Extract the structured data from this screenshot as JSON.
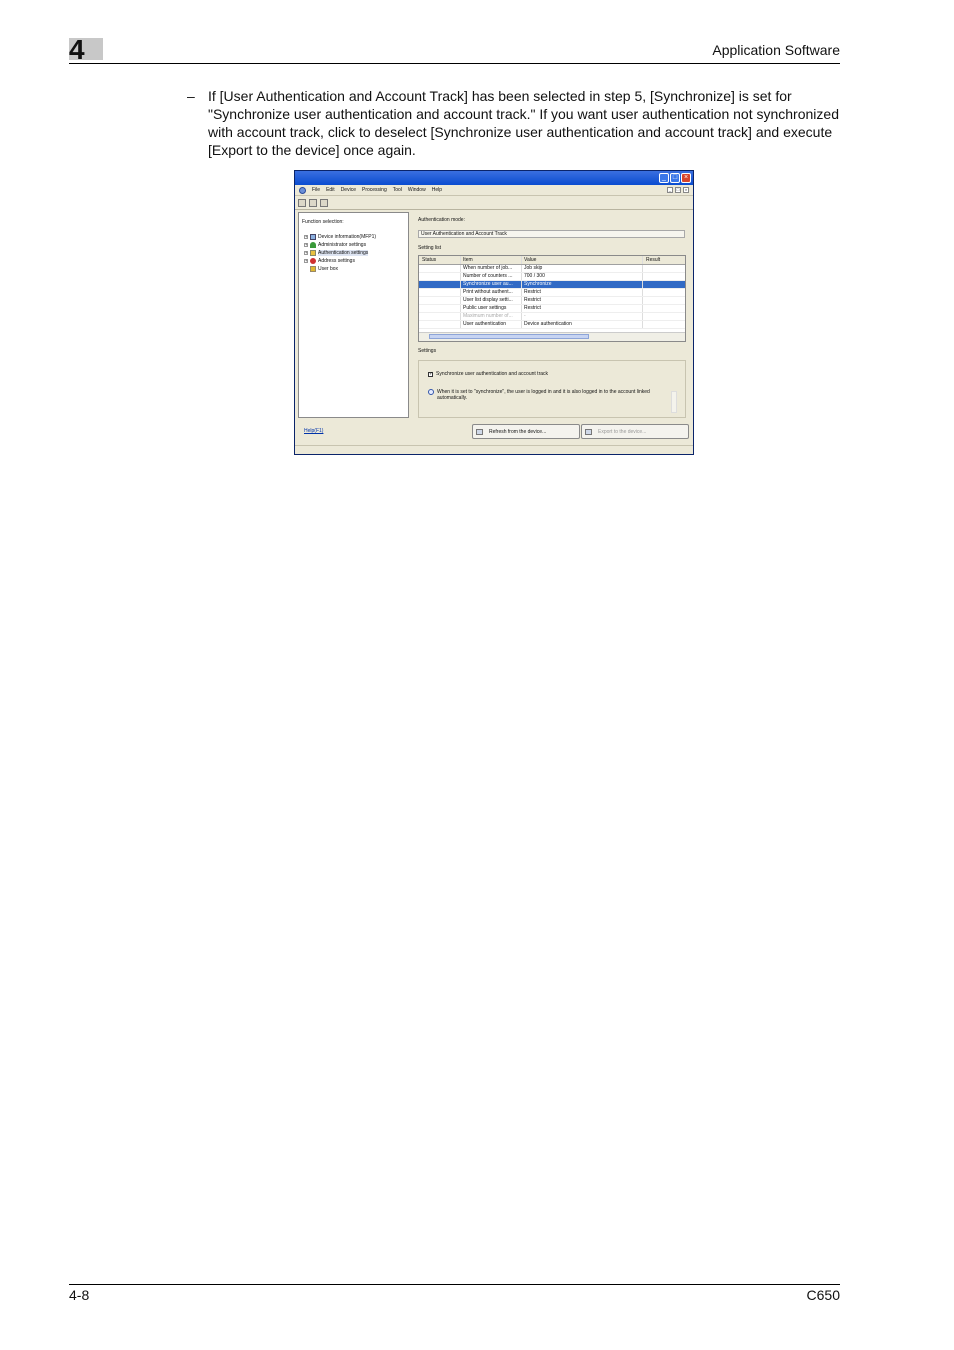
{
  "header": {
    "chapter": "4",
    "title": "Application Software"
  },
  "body": {
    "bullet": "–",
    "paragraph": "If [User Authentication and Account Track] has been selected in step 5, [Synchronize] is set for \"Synchronize user authentication and account track.\" If you want user authentication not synchronized with account track, click to deselect [Synchronize user authentication and account track] and execute [Export to the device] once again."
  },
  "screenshot": {
    "menu": [
      "File",
      "Edit",
      "Device",
      "Processing",
      "Tool",
      "Window",
      "Help"
    ],
    "function_selection_label": "Function selection:",
    "tree": [
      {
        "label": "Device information(MFP1)"
      },
      {
        "label": "Administrator settings"
      },
      {
        "label": "Authentication settings"
      },
      {
        "label": "Address settings"
      },
      {
        "label": "User box"
      }
    ],
    "auth_mode_label": "Authentication mode:",
    "auth_mode_value": "User Authentication and Account Track",
    "setting_list_label": "Setting list",
    "table": {
      "headers": [
        "Status",
        "Item",
        "Value",
        "Result"
      ],
      "rows": [
        {
          "item": "When number of job...",
          "value": "Job skip"
        },
        {
          "item": "Number of counters ...",
          "value": "700 / 300"
        },
        {
          "item": "Synchronize user au...",
          "value": "Synchronize"
        },
        {
          "item": "Print without authent...",
          "value": "Restrict"
        },
        {
          "item": "User list display setti...",
          "value": "Restrict"
        },
        {
          "item": "Public user settings",
          "value": "Restrict"
        },
        {
          "item": "Maximum number of...",
          "value": "-"
        },
        {
          "item": "User authentication",
          "value": "Device authentication"
        }
      ]
    },
    "settings_label": "Settings",
    "sync_checkbox_label": "Synchronize user authentication and account track",
    "info_text": "When it is set to \"synchronize\", the user is logged in and it is also logged in to the account linked automatically.",
    "help_link": "Help(F1)",
    "refresh_button": "Refresh from the device...",
    "export_button": "Export to the device..."
  },
  "footer": {
    "page": "4-8",
    "model": "C650"
  }
}
